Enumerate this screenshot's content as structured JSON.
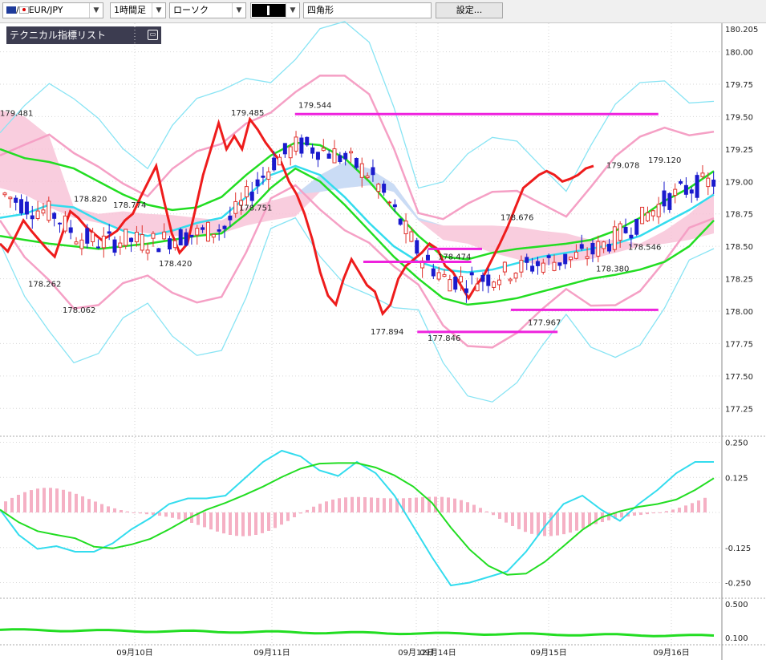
{
  "toolbar": {
    "symbol": "EUR/JPY",
    "symbol_prefix": "/",
    "timeframe": "1時間足",
    "chart_style": "ローソク",
    "shape_tool": "四角形",
    "settings_label": "設定..."
  },
  "indicator_panel": {
    "title": "テクニカル指標リスト"
  },
  "colors": {
    "bull_candle": "#e0322d",
    "bear_candle": "#1a1acd",
    "red_line": "#ee1c1c",
    "green_line": "#22dd22",
    "cyan_line": "#33dcee",
    "bollinger_outer": "#88e4f4",
    "bollinger_inner": "#f5a0c5",
    "cloud_bull": "#f7c0d6",
    "cloud_bear": "#c4def7",
    "magenta": "#ee22dd",
    "histogram": "#f5b0c4"
  },
  "chart_data": [
    {
      "type": "candlestick",
      "ylim": [
        177.06,
        180.22
      ],
      "yticks": [
        "180.00",
        "179.75",
        "179.50",
        "179.25",
        "179.00",
        "178.75",
        "178.50",
        "178.25",
        "178.00",
        "177.75",
        "177.50",
        "177.25"
      ],
      "top_label": "180.205",
      "x_labels": [
        "09月10日",
        "09月11日",
        "09月12日",
        "09月14日",
        "09月15日",
        "09月16日"
      ],
      "annotations": [
        {
          "text": "179.481",
          "value": 179.481
        },
        {
          "text": "178.820",
          "value": 178.82
        },
        {
          "text": "178.774",
          "value": 178.774
        },
        {
          "text": "178.262",
          "value": 178.262
        },
        {
          "text": "178.062",
          "value": 178.062
        },
        {
          "text": "178.420",
          "value": 178.42
        },
        {
          "text": "179.485",
          "value": 179.485
        },
        {
          "text": "178.751",
          "value": 178.751
        },
        {
          "text": "179.544",
          "value": 179.544
        },
        {
          "text": "177.894",
          "value": 177.894
        },
        {
          "text": "177.846",
          "value": 177.846
        },
        {
          "text": "178.474",
          "value": 178.474
        },
        {
          "text": "178.676",
          "value": 178.676
        },
        {
          "text": "177.967",
          "value": 177.967
        },
        {
          "text": "178.380",
          "value": 178.38
        },
        {
          "text": "179.078",
          "value": 179.078
        },
        {
          "text": "179.120",
          "value": 179.12
        },
        {
          "text": "178.546",
          "value": 178.546
        }
      ],
      "horizontal_levels": [
        {
          "value": 179.52,
          "from": 0.41,
          "to": 0.915
        },
        {
          "value": 178.38,
          "from": 0.505,
          "to": 0.655
        },
        {
          "value": 178.48,
          "from": 0.595,
          "to": 0.67
        },
        {
          "value": 178.01,
          "from": 0.71,
          "to": 0.915
        },
        {
          "value": 177.84,
          "from": 0.58,
          "to": 0.775
        }
      ],
      "series": [
        {
          "name": "",
          "values": [
            178.52,
            178.46,
            178.58,
            178.7,
            178.62,
            178.55,
            178.48,
            178.42,
            178.6,
            178.77,
            178.72,
            178.65,
            178.6,
            178.55,
            178.58,
            178.62,
            178.7,
            178.75,
            178.88,
            179.0,
            179.12,
            178.85,
            178.6,
            178.45,
            178.52,
            178.78,
            179.05,
            179.25,
            179.45,
            179.25,
            179.35,
            179.25,
            179.48,
            179.4,
            179.3,
            179.22,
            179.15,
            179.0,
            178.9,
            178.75,
            178.55,
            178.3,
            178.12,
            178.05,
            178.25,
            178.4,
            178.3,
            178.2,
            178.15,
            177.98,
            178.05,
            178.25,
            178.35,
            178.4,
            178.45,
            178.52,
            178.48,
            178.35,
            178.3,
            178.2,
            178.1,
            178.2,
            178.28,
            178.4,
            178.52,
            178.65,
            178.8,
            178.95,
            179.0,
            179.05,
            179.08,
            179.05,
            179.0,
            179.02,
            179.05,
            179.1,
            179.12
          ]
        }
      ]
    },
    {
      "type": "line",
      "ylim": [
        -0.3,
        0.26
      ],
      "yticks": [
        "0.250",
        "0.125",
        "-0.125",
        "-0.250"
      ],
      "series": [
        {
          "name": "",
          "values": [
            0.01,
            -0.08,
            -0.13,
            -0.12,
            -0.14,
            -0.14,
            -0.11,
            -0.06,
            -0.02,
            0.03,
            0.05,
            0.05,
            0.06,
            0.12,
            0.18,
            0.22,
            0.2,
            0.15,
            0.13,
            0.18,
            0.14,
            0.06,
            -0.05,
            -0.16,
            -0.26,
            -0.25,
            -0.23,
            -0.21,
            -0.14,
            -0.05,
            0.03,
            0.06,
            0.01,
            -0.03,
            0.03,
            0.08,
            0.14,
            0.18,
            0.18
          ]
        }
      ]
    },
    {
      "type": "line",
      "ylim": [
        0.05,
        0.55
      ],
      "yticks": [
        "0.500",
        "0.100"
      ]
    }
  ]
}
